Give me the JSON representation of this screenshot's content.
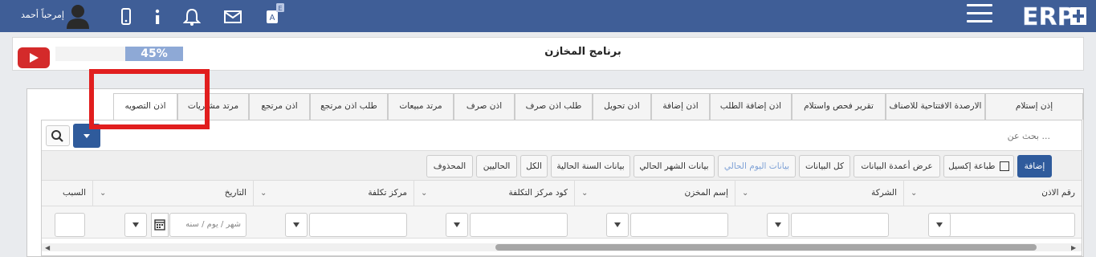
{
  "header": {
    "user_name": "إمرحباً أحمد",
    "icons": [
      "avatar-icon",
      "mobile-icon",
      "info-icon",
      "bell-icon",
      "mail-icon",
      "translate-icon",
      "hamburger-icon",
      "erp-logo"
    ],
    "translate_badge": "E",
    "logo_text": "ERP"
  },
  "page": {
    "title": "برنامج المخازن",
    "progress_percent": 45,
    "progress_label": "45%"
  },
  "tabs": [
    {
      "label": "إذن إستلام"
    },
    {
      "label": "الارصدة الافتتاحية للاصناف"
    },
    {
      "label": "تقرير فحص واستلام"
    },
    {
      "label": "اذن إضافة الطلب"
    },
    {
      "label": "اذن إضافة"
    },
    {
      "label": "اذن تحويل"
    },
    {
      "label": "طلب اذن صرف"
    },
    {
      "label": "اذن صرف"
    },
    {
      "label": "مرتد مبيعات"
    },
    {
      "label": "طلب اذن مرتجع"
    },
    {
      "label": "اذن مرتجع"
    },
    {
      "label": "مرتد مشتريات"
    },
    {
      "label": "اذن التصويه"
    }
  ],
  "search": {
    "placeholder": "بحث عن ..."
  },
  "toolbar": {
    "add": "إضافة",
    "print_excel": "طباعة إكسيل",
    "show_columns": "عرض أعمدة البيانات",
    "all_data": "كل البيانات",
    "today_data": "بيانات اليوم الحالي",
    "month_data": "بيانات الشهر الحالي",
    "year_data": "بيانات السنة الحالية",
    "all": "الكل",
    "current": "الحاليين",
    "deleted": "المحذوف"
  },
  "columns": [
    {
      "label": "رقم الاذن"
    },
    {
      "label": "الشركة"
    },
    {
      "label": "إسم المخزن"
    },
    {
      "label": "كود مركز التكلفة"
    },
    {
      "label": "مركز تكلفة"
    },
    {
      "label": "التاريخ"
    },
    {
      "label": "السبب"
    }
  ],
  "date_filter": {
    "placeholder": "شهر / يوم / سنه"
  },
  "chevron": "⌄"
}
